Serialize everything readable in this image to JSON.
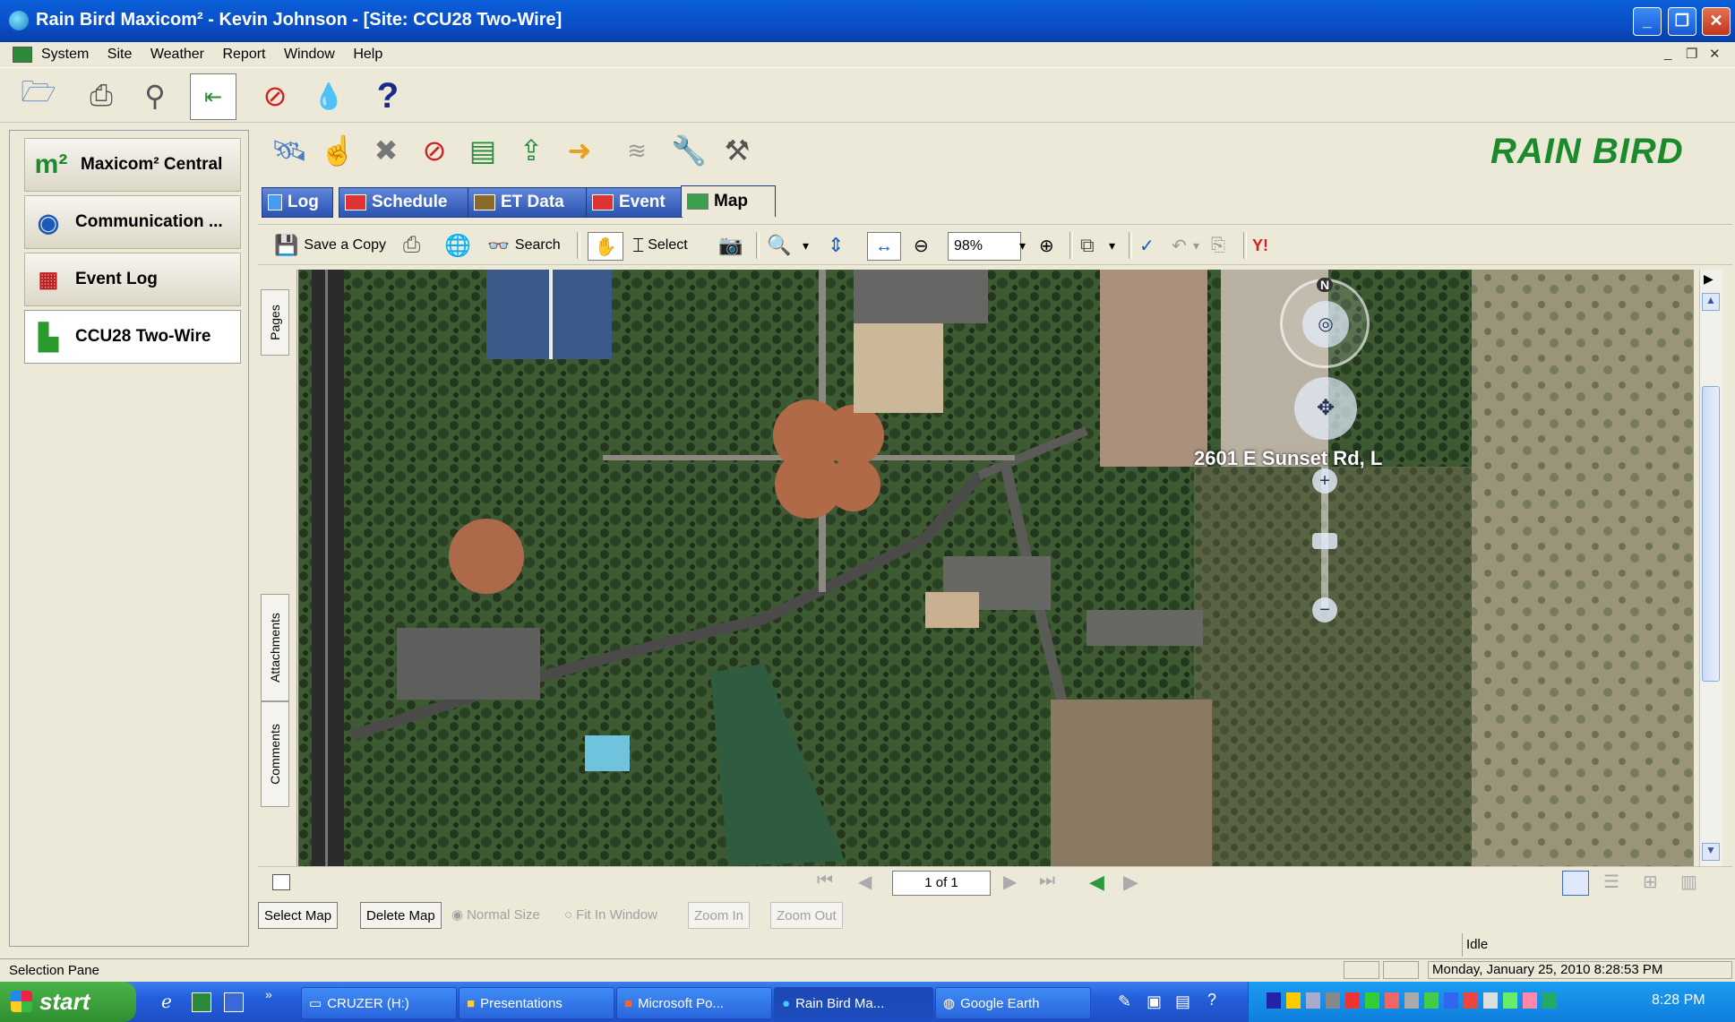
{
  "window": {
    "title": "Rain Bird Maxicom² - Kevin Johnson   - [Site: CCU28 Two-Wire]"
  },
  "menu": [
    "System",
    "Site",
    "Weather",
    "Report",
    "Window",
    "Help"
  ],
  "sidebar": {
    "items": [
      {
        "label": "Maxicom² Central",
        "icon": "m2-logo-icon"
      },
      {
        "label": "Communication ...",
        "icon": "antenna-icon"
      },
      {
        "label": "Event Log",
        "icon": "calendar-icon"
      },
      {
        "label": "CCU28 Two-Wire",
        "icon": "site-icon"
      }
    ]
  },
  "brand": {
    "logo_text": "RAIN BIRD"
  },
  "tabs": [
    {
      "label": "Log",
      "active": false
    },
    {
      "label": "Schedule",
      "active": false
    },
    {
      "label": "ET Data",
      "active": false
    },
    {
      "label": "Event",
      "active": false
    },
    {
      "label": "Map",
      "active": true
    }
  ],
  "pdf_toolbar": {
    "save_copy": "Save a Copy",
    "search": "Search",
    "select": "Select",
    "zoom": "98%"
  },
  "side_tabs": [
    "Pages",
    "Attachments",
    "Comments"
  ],
  "map": {
    "address_label": "2601 E Sunset Rd, L",
    "compass_label": "N"
  },
  "navbar": {
    "page_indicator": "1 of 1"
  },
  "map_buttons": {
    "select_map": "Select Map",
    "delete_map": "Delete Map",
    "normal_size": "Normal Size",
    "fit_in_window": "Fit In Window",
    "zoom_in": "Zoom In",
    "zoom_out": "Zoom Out"
  },
  "status": {
    "left": "Selection Pane",
    "idle": "Idle",
    "datetime": "Monday, January 25, 2010 8:28:53 PM"
  },
  "taskbar": {
    "start": "start",
    "tasks": [
      "CRUZER (H:)",
      "Presentations",
      "Microsoft Po...",
      "Rain Bird Ma...",
      "Google Earth"
    ],
    "clock": "8:28 PM"
  },
  "colors": {
    "brand_green": "#1a8a2a",
    "title_blue": "#0a4ec6",
    "tab_blue": "#2a53b0"
  }
}
